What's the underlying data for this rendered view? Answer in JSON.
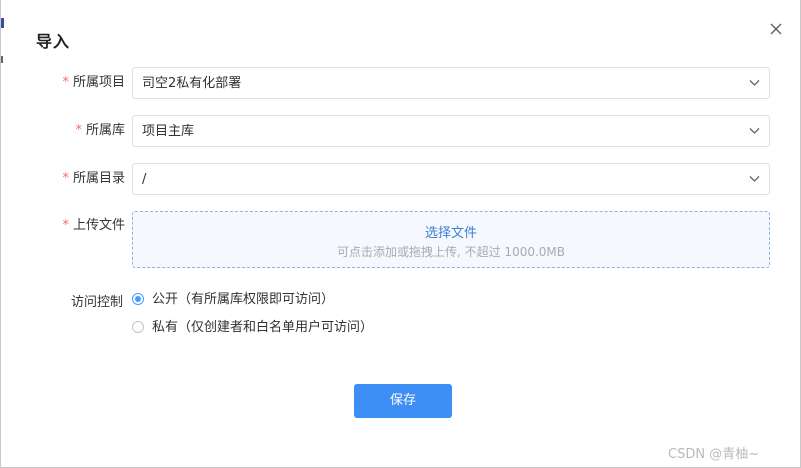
{
  "dialog": {
    "title": "导入",
    "close_icon": "close-icon"
  },
  "form": {
    "project": {
      "label": "所属项目",
      "required": true,
      "value": "司空2私有化部署"
    },
    "library": {
      "label": "所属库",
      "required": true,
      "value": "项目主库"
    },
    "directory": {
      "label": "所属目录",
      "required": true,
      "value": "/"
    },
    "upload": {
      "label": "上传文件",
      "required": true,
      "pick_text": "选择文件",
      "hint": "可点击添加或拖拽上传, 不超过 1000.0MB"
    },
    "access": {
      "label": "访问控制",
      "options": [
        {
          "label": "公开（有所属库权限即可访问）",
          "selected": true
        },
        {
          "label": "私有（仅创建者和白名单用户可访问）",
          "selected": false
        }
      ]
    }
  },
  "footer": {
    "save_label": "保存"
  },
  "watermark": "CSDN @青柚~",
  "colors": {
    "primary": "#3d8ef5",
    "required": "#f56c6c",
    "link": "#3b7fd6"
  }
}
